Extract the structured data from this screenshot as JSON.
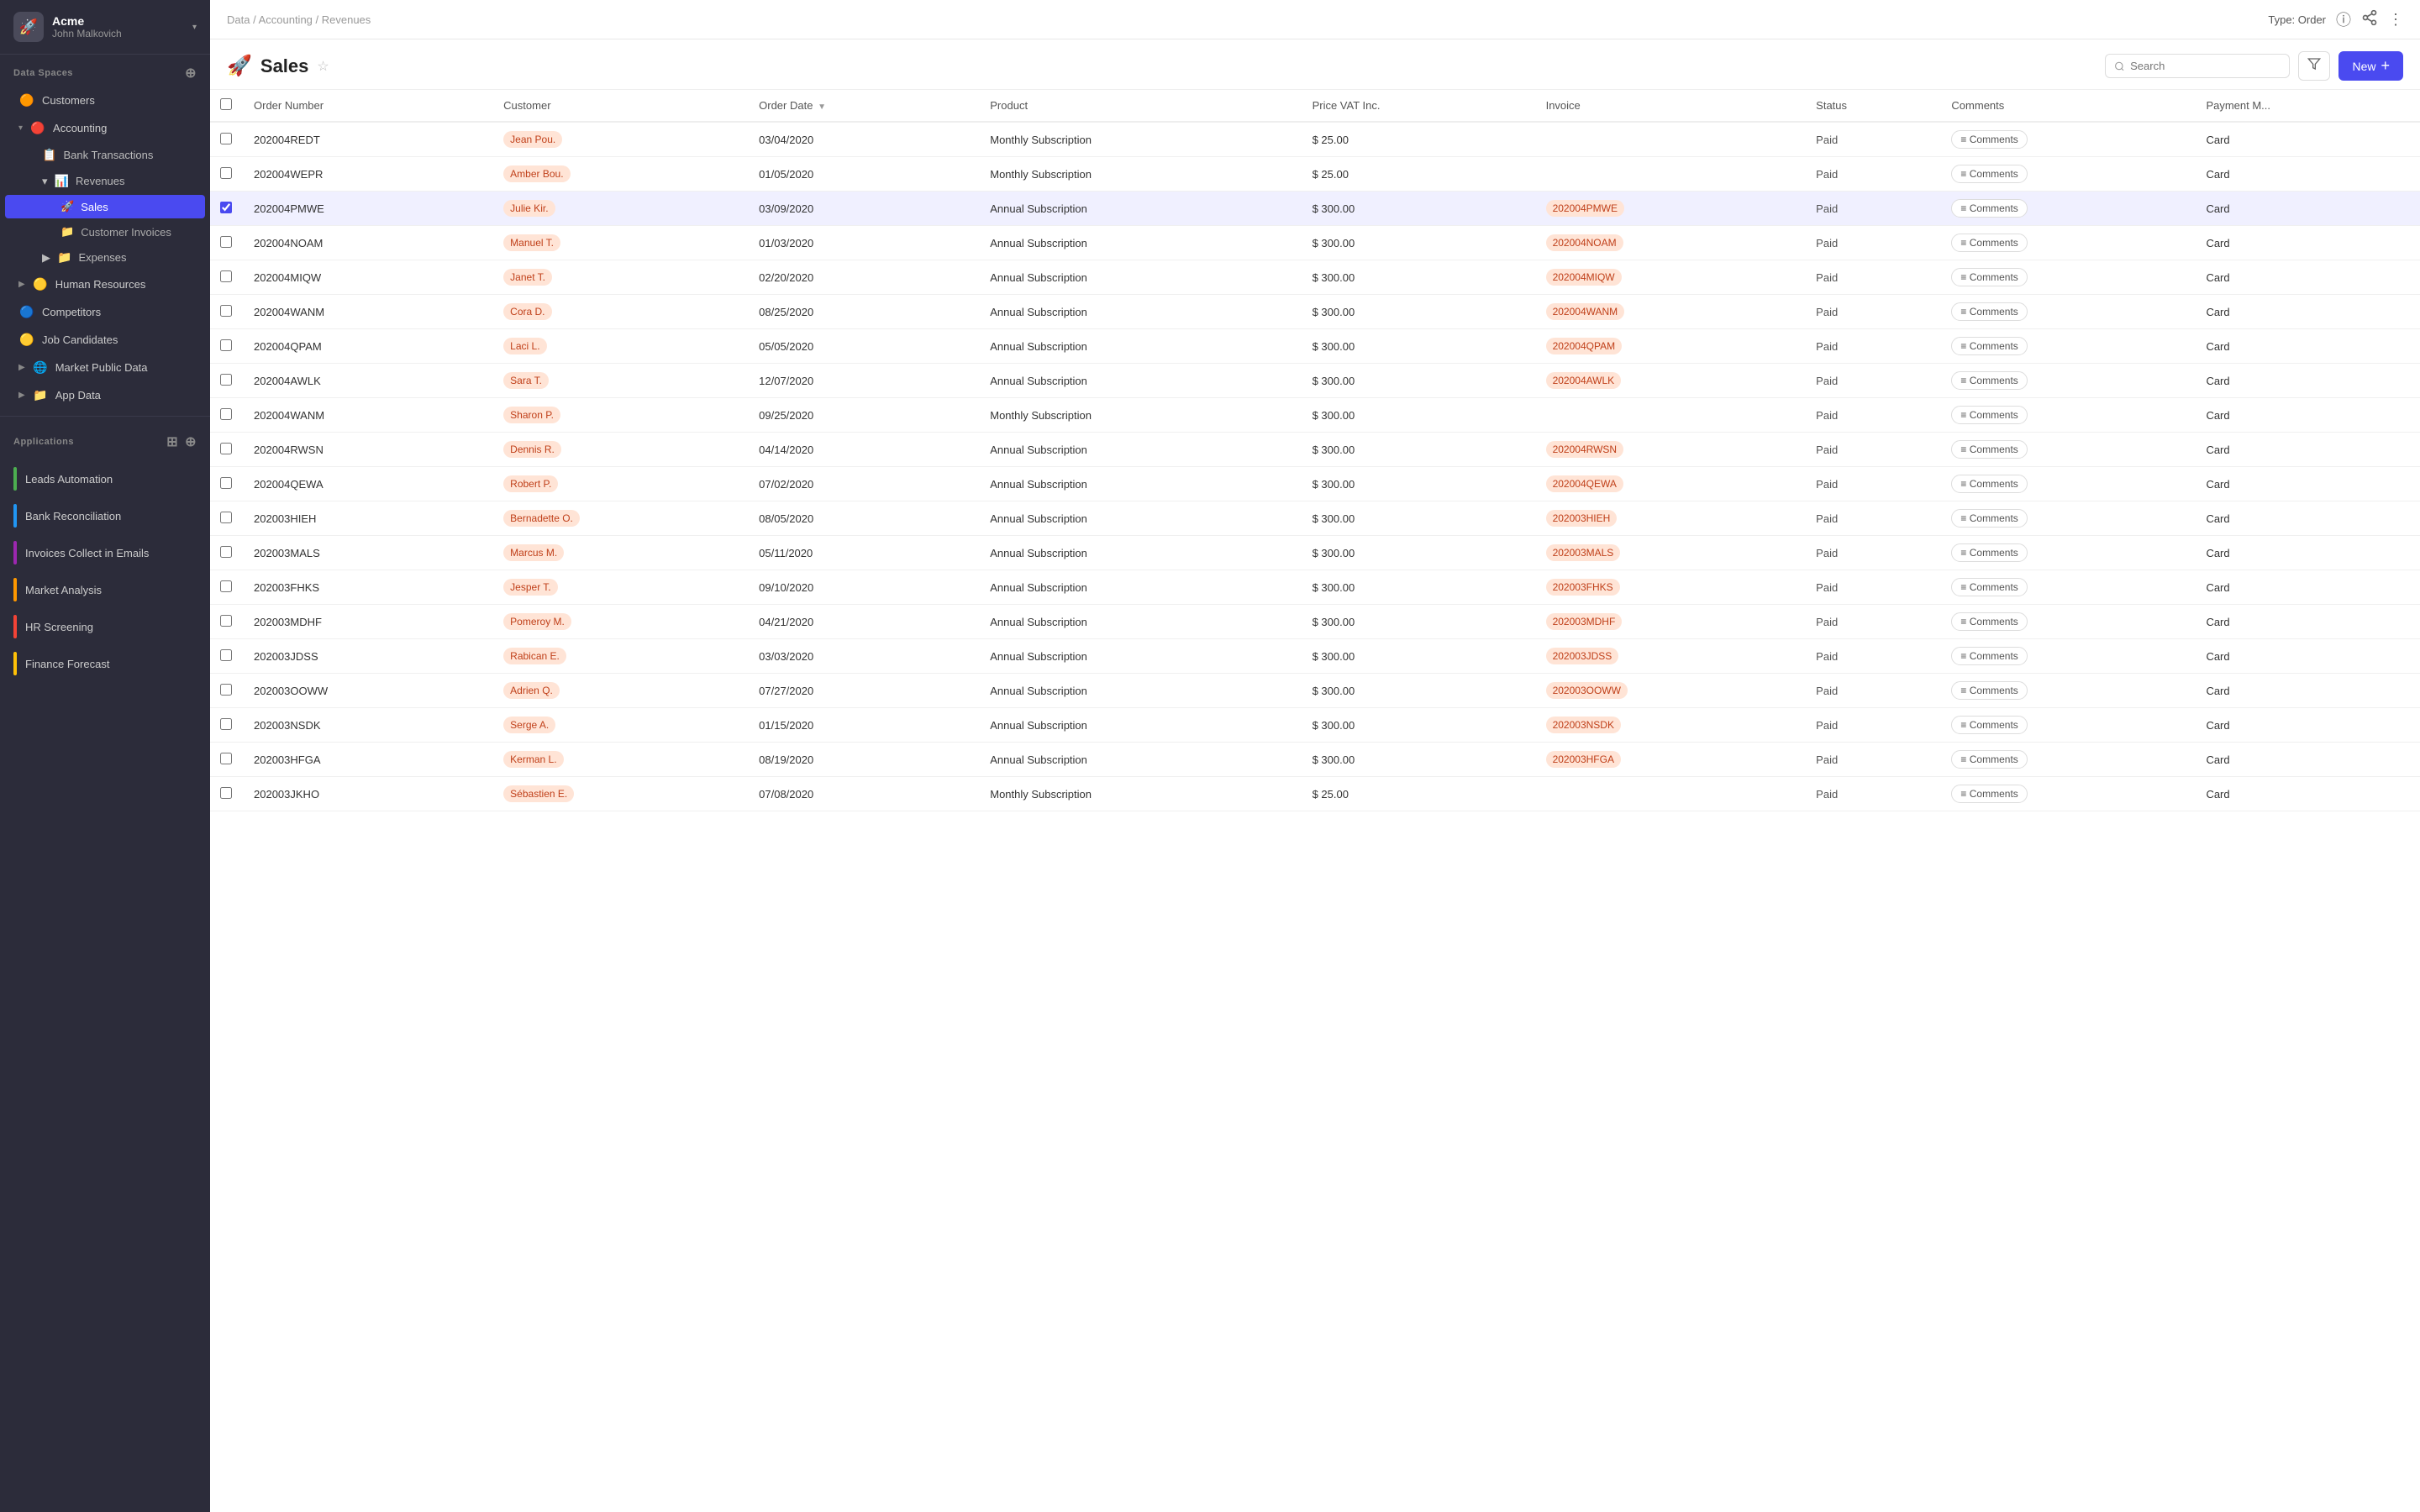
{
  "sidebar": {
    "company": "Acme",
    "company_chevron": "▾",
    "user": "John Malkovich",
    "logo_icon": "🚀",
    "data_spaces_label": "Data Spaces",
    "items": [
      {
        "id": "customers",
        "label": "Customers",
        "icon": "🟠",
        "expanded": false
      },
      {
        "id": "accounting",
        "label": "Accounting",
        "icon": "🔴",
        "expanded": true
      },
      {
        "id": "bank-transactions",
        "label": "Bank Transactions",
        "icon": "📋",
        "indent": 1
      },
      {
        "id": "revenues",
        "label": "Revenues",
        "icon": "📊",
        "indent": 1,
        "expanded": true
      },
      {
        "id": "sales",
        "label": "Sales",
        "icon": "🚀",
        "indent": 2,
        "active": true
      },
      {
        "id": "customer-invoices",
        "label": "Customer Invoices",
        "icon": "📁",
        "indent": 2
      },
      {
        "id": "expenses",
        "label": "Expenses",
        "icon": "📁",
        "indent": 1
      },
      {
        "id": "human-resources",
        "label": "Human Resources",
        "icon": "🟡",
        "expanded": false
      },
      {
        "id": "competitors",
        "label": "Competitors",
        "icon": "🔵",
        "expanded": false
      },
      {
        "id": "job-candidates",
        "label": "Job Candidates",
        "icon": "🟡",
        "expanded": false
      },
      {
        "id": "market-public-data",
        "label": "Market Public Data",
        "icon": "🌐",
        "expanded": false
      },
      {
        "id": "app-data",
        "label": "App Data",
        "icon": "📁",
        "expanded": false
      }
    ],
    "applications_label": "Applications",
    "apps": [
      {
        "id": "leads-automation",
        "label": "Leads Automation",
        "color": "#4caf50"
      },
      {
        "id": "bank-reconciliation",
        "label": "Bank Reconciliation",
        "color": "#2196f3"
      },
      {
        "id": "invoices-collect",
        "label": "Invoices Collect in Emails",
        "color": "#9c27b0"
      },
      {
        "id": "market-analysis",
        "label": "Market Analysis",
        "color": "#ff9800"
      },
      {
        "id": "hr-screening",
        "label": "HR Screening",
        "color": "#f44336"
      },
      {
        "id": "finance-forecast",
        "label": "Finance Forecast",
        "color": "#ffc107"
      }
    ]
  },
  "topbar": {
    "breadcrumb": "Data / Accounting / Revenues",
    "type_label": "Type: Order",
    "share_icon": "share",
    "more_icon": "more"
  },
  "page": {
    "title": "Sales",
    "title_icon": "🚀",
    "search_placeholder": "Search",
    "new_label": "New"
  },
  "table": {
    "columns": [
      {
        "id": "checkbox",
        "label": ""
      },
      {
        "id": "order-number",
        "label": "Order Number"
      },
      {
        "id": "customer",
        "label": "Customer"
      },
      {
        "id": "order-date",
        "label": "Order Date",
        "sortable": true
      },
      {
        "id": "product",
        "label": "Product"
      },
      {
        "id": "price-vat",
        "label": "Price VAT Inc."
      },
      {
        "id": "invoice",
        "label": "Invoice"
      },
      {
        "id": "status",
        "label": "Status"
      },
      {
        "id": "comments",
        "label": "Comments"
      },
      {
        "id": "payment-method",
        "label": "Payment M..."
      }
    ],
    "rows": [
      {
        "order_number": "202004REDT",
        "customer": "Jean Pou.",
        "order_date": "03/04/2020",
        "product": "Monthly Subscription",
        "price": "$ 25.00",
        "invoice": "",
        "status": "Paid",
        "has_comments": true,
        "payment_method": "Card",
        "selected": false
      },
      {
        "order_number": "202004WEPR",
        "customer": "Amber Bou.",
        "order_date": "01/05/2020",
        "product": "Monthly Subscription",
        "price": "$ 25.00",
        "invoice": "",
        "status": "Paid",
        "has_comments": true,
        "payment_method": "Card",
        "selected": false
      },
      {
        "order_number": "202004PMWE",
        "customer": "Julie Kir.",
        "order_date": "03/09/2020",
        "product": "Annual Subscription",
        "price": "$ 300.00",
        "invoice": "202004PMWE",
        "status": "Paid",
        "has_comments": true,
        "payment_method": "Card",
        "selected": true
      },
      {
        "order_number": "202004NOAM",
        "customer": "Manuel T.",
        "order_date": "01/03/2020",
        "product": "Annual Subscription",
        "price": "$ 300.00",
        "invoice": "202004NOAM",
        "status": "Paid",
        "has_comments": true,
        "payment_method": "Card",
        "selected": false
      },
      {
        "order_number": "202004MIQW",
        "customer": "Janet T.",
        "order_date": "02/20/2020",
        "product": "Annual Subscription",
        "price": "$ 300.00",
        "invoice": "202004MIQW",
        "status": "Paid",
        "has_comments": true,
        "payment_method": "Card",
        "selected": false
      },
      {
        "order_number": "202004WANM",
        "customer": "Cora D.",
        "order_date": "08/25/2020",
        "product": "Annual Subscription",
        "price": "$ 300.00",
        "invoice": "202004WANM",
        "status": "Paid",
        "has_comments": true,
        "payment_method": "Card",
        "selected": false
      },
      {
        "order_number": "202004QPAM",
        "customer": "Laci L.",
        "order_date": "05/05/2020",
        "product": "Annual Subscription",
        "price": "$ 300.00",
        "invoice": "202004QPAM",
        "status": "Paid",
        "has_comments": true,
        "payment_method": "Card",
        "selected": false
      },
      {
        "order_number": "202004AWLK",
        "customer": "Sara T.",
        "order_date": "12/07/2020",
        "product": "Annual Subscription",
        "price": "$ 300.00",
        "invoice": "202004AWLK",
        "status": "Paid",
        "has_comments": true,
        "payment_method": "Card",
        "selected": false
      },
      {
        "order_number": "202004WANM",
        "customer": "Sharon P.",
        "order_date": "09/25/2020",
        "product": "Monthly Subscription",
        "price": "$ 300.00",
        "invoice": "",
        "status": "Paid",
        "has_comments": true,
        "payment_method": "Card",
        "selected": false
      },
      {
        "order_number": "202004RWSN",
        "customer": "Dennis R.",
        "order_date": "04/14/2020",
        "product": "Annual Subscription",
        "price": "$ 300.00",
        "invoice": "202004RWSN",
        "status": "Paid",
        "has_comments": true,
        "payment_method": "Card",
        "selected": false
      },
      {
        "order_number": "202004QEWA",
        "customer": "Robert P.",
        "order_date": "07/02/2020",
        "product": "Annual Subscription",
        "price": "$ 300.00",
        "invoice": "202004QEWA",
        "status": "Paid",
        "has_comments": true,
        "payment_method": "Card",
        "selected": false
      },
      {
        "order_number": "202003HIEH",
        "customer": "Bernadette O.",
        "order_date": "08/05/2020",
        "product": "Annual Subscription",
        "price": "$ 300.00",
        "invoice": "202003HIEH",
        "status": "Paid",
        "has_comments": true,
        "payment_method": "Card",
        "selected": false
      },
      {
        "order_number": "202003MALS",
        "customer": "Marcus M.",
        "order_date": "05/11/2020",
        "product": "Annual Subscription",
        "price": "$ 300.00",
        "invoice": "202003MALS",
        "status": "Paid",
        "has_comments": true,
        "payment_method": "Card",
        "selected": false
      },
      {
        "order_number": "202003FHKS",
        "customer": "Jesper T.",
        "order_date": "09/10/2020",
        "product": "Annual Subscription",
        "price": "$ 300.00",
        "invoice": "202003FHKS",
        "status": "Paid",
        "has_comments": true,
        "payment_method": "Card",
        "selected": false
      },
      {
        "order_number": "202003MDHF",
        "customer": "Pomeroy M.",
        "order_date": "04/21/2020",
        "product": "Annual Subscription",
        "price": "$ 300.00",
        "invoice": "202003MDHF",
        "status": "Paid",
        "has_comments": true,
        "payment_method": "Card",
        "selected": false
      },
      {
        "order_number": "202003JDSS",
        "customer": "Rabican E.",
        "order_date": "03/03/2020",
        "product": "Annual Subscription",
        "price": "$ 300.00",
        "invoice": "202003JDSS",
        "status": "Paid",
        "has_comments": true,
        "payment_method": "Card",
        "selected": false
      },
      {
        "order_number": "202003OOWW",
        "customer": "Adrien Q.",
        "order_date": "07/27/2020",
        "product": "Annual Subscription",
        "price": "$ 300.00",
        "invoice": "202003OOWW",
        "status": "Paid",
        "has_comments": true,
        "payment_method": "Card",
        "selected": false
      },
      {
        "order_number": "202003NSDK",
        "customer": "Serge A.",
        "order_date": "01/15/2020",
        "product": "Annual Subscription",
        "price": "$ 300.00",
        "invoice": "202003NSDK",
        "status": "Paid",
        "has_comments": true,
        "payment_method": "Card",
        "selected": false
      },
      {
        "order_number": "202003HFGA",
        "customer": "Kerman L.",
        "order_date": "08/19/2020",
        "product": "Annual Subscription",
        "price": "$ 300.00",
        "invoice": "202003HFGA",
        "status": "Paid",
        "has_comments": true,
        "payment_method": "Card",
        "selected": false
      },
      {
        "order_number": "202003JKHO",
        "customer": "Sébastien E.",
        "order_date": "07/08/2020",
        "product": "Monthly Subscription",
        "price": "$ 25.00",
        "invoice": "",
        "status": "Paid",
        "has_comments": true,
        "payment_method": "Card",
        "selected": false
      }
    ]
  }
}
